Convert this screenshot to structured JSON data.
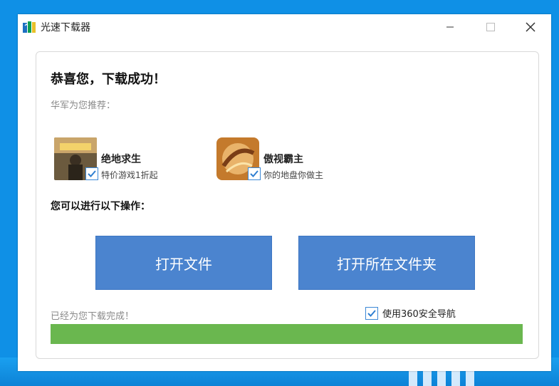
{
  "window": {
    "title": "光速下载器"
  },
  "content": {
    "headline": "恭喜您，下载成功！",
    "recommend_label": "华军为您推荐：",
    "recommendations": [
      {
        "name": "绝地求生",
        "desc": "特价游戏1折起",
        "checked": true
      },
      {
        "name": "傲视霸主",
        "desc": "你的地盘你做主",
        "checked": true
      }
    ],
    "ops_label": "您可以进行以下操作：",
    "buttons": {
      "open_file": "打开文件",
      "open_folder": "打开所在文件夹"
    },
    "done_text": "已经为您下载完成！",
    "nav_option": {
      "label": "使用360安全导航",
      "checked": true
    },
    "progress": {
      "percent": 100,
      "color": "#6ab74f"
    }
  },
  "colors": {
    "accent": "#4b84cf",
    "desktop": "#0f90e6"
  }
}
